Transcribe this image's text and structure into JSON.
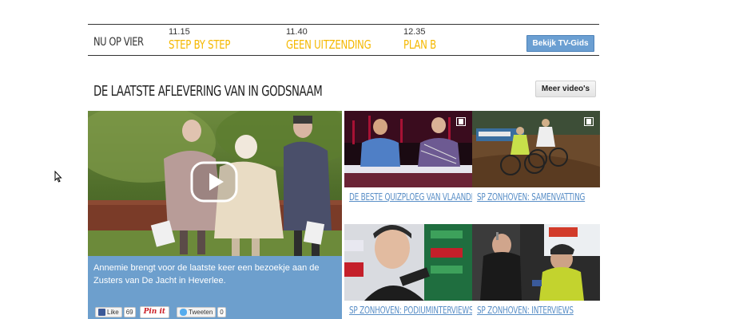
{
  "tv_guide": {
    "now_label": "NU OP VIER",
    "programs": [
      {
        "time": "11.15",
        "title": "STEP BY STEP"
      },
      {
        "time": "11.40",
        "title": "GEEN UITZENDING"
      },
      {
        "time": "12.35",
        "title": "PLAN B"
      }
    ],
    "button_label": "Bekijk TV-Gids"
  },
  "section": {
    "title": "DE LAATSTE AFLEVERING VAN IN GODSNAAM",
    "more_button": "Meer video's"
  },
  "featured": {
    "caption": "Annemie brengt voor de laatste keer een bezoekje aan de Zusters van De Jacht in Heverlee.",
    "share": {
      "like_label": "Like",
      "like_count": "69",
      "pin_label": "Pin it",
      "tweet_label": "Tweeten",
      "tweet_count": "0"
    }
  },
  "thumbnails": [
    {
      "label": "DE BESTE QUIZPLOEG VAN VLAANDEREN"
    },
    {
      "label": "SP ZONHOVEN: SAMENVATTING"
    },
    {
      "label": "SP ZONHOVEN: PODIUMINTERVIEWS"
    },
    {
      "label": "SP ZONHOVEN: INTERVIEWS"
    }
  ],
  "colors": {
    "accent_yellow": "#f5b800",
    "link_blue": "#5a8fc7",
    "caption_bg": "#6d9fcd",
    "button_blue": "#6b9fd2"
  }
}
